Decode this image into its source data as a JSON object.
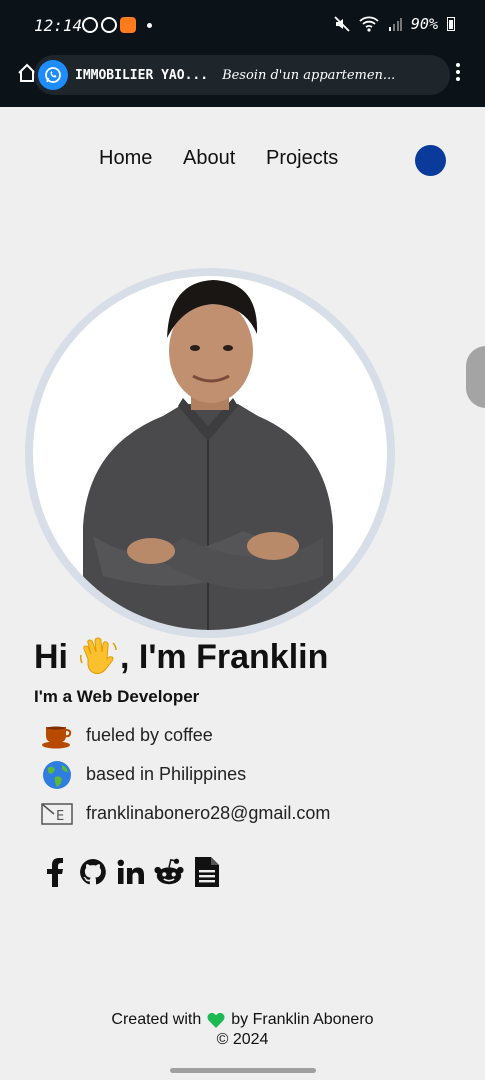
{
  "statusbar": {
    "time": "12:14",
    "battery": "90%"
  },
  "chat_head": {
    "name": "IMMOBILIER YAO...",
    "message": "Besoin d'un appartemen..."
  },
  "nav": {
    "items": [
      {
        "label": "Home"
      },
      {
        "label": "About"
      },
      {
        "label": "Projects"
      }
    ]
  },
  "profile": {
    "greeting_pre": "Hi",
    "greeting_post": ", I'm Franklin",
    "role": "I'm a Web Developer",
    "facts": [
      {
        "icon": "coffee-icon",
        "text": "fueled by coffee"
      },
      {
        "icon": "globe-icon",
        "text": "based in Philippines"
      },
      {
        "icon": "envelope-icon",
        "text": "franklinabonero28@gmail.com"
      }
    ]
  },
  "socials": [
    {
      "icon": "facebook-icon"
    },
    {
      "icon": "github-icon"
    },
    {
      "icon": "linkedin-icon"
    },
    {
      "icon": "reddit-icon"
    },
    {
      "icon": "resume-icon"
    }
  ],
  "footer": {
    "created_pre": "Created with",
    "created_post": "by Franklin Abonero",
    "copyright": "©  2024"
  },
  "colors": {
    "background": "#efefef",
    "theme_toggle": "#0a3a9a",
    "heart": "#1db954",
    "statusbar": "#0c1318"
  }
}
